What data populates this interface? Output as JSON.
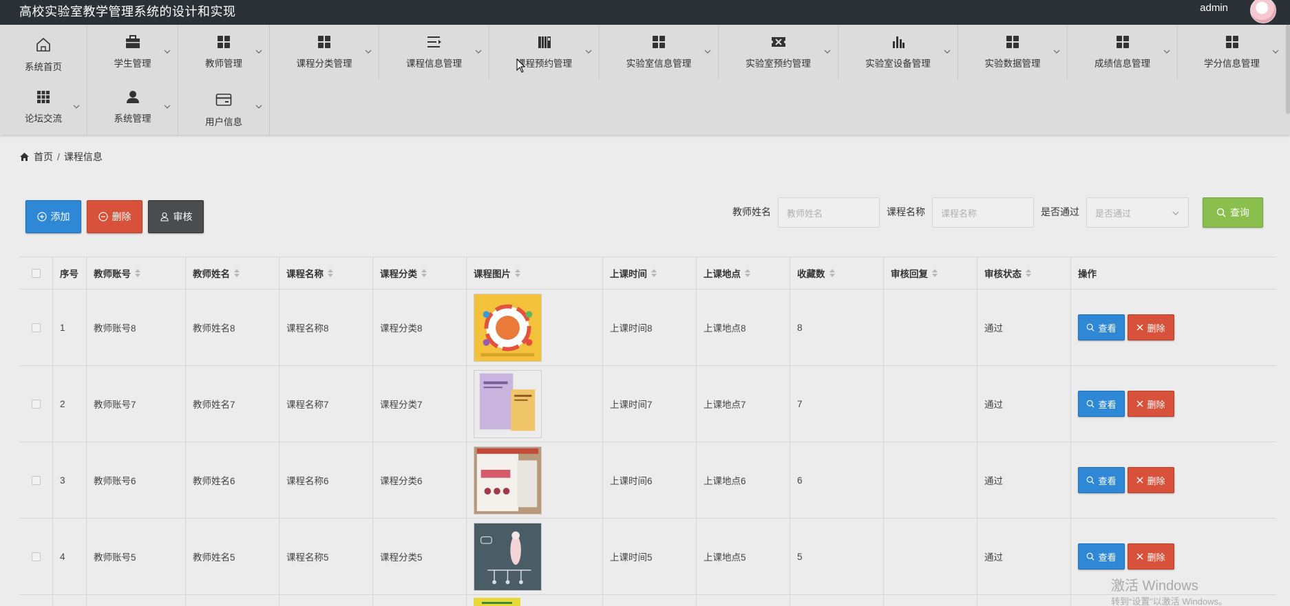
{
  "app": {
    "title": "高校实验室教学管理系统的设计和实现",
    "user": "admin"
  },
  "nav": {
    "row1": [
      {
        "label": "系统首页",
        "icon": "home-icon"
      },
      {
        "label": "学生管理",
        "icon": "briefcase-icon"
      },
      {
        "label": "教师管理",
        "icon": "grid-icon"
      },
      {
        "label": "课程分类管理",
        "icon": "grid-icon"
      },
      {
        "label": "课程信息管理",
        "icon": "list-icon"
      },
      {
        "label": "课程预约管理",
        "icon": "book-icon"
      },
      {
        "label": "实验室信息管理",
        "icon": "grid-icon"
      },
      {
        "label": "实验室预约管理",
        "icon": "ticket-icon"
      },
      {
        "label": "实验室设备管理",
        "icon": "bar-chart-icon"
      },
      {
        "label": "实验数据管理",
        "icon": "grid-icon"
      },
      {
        "label": "成绩信息管理",
        "icon": "grid-icon"
      },
      {
        "label": "学分信息管理",
        "icon": "grid-icon"
      }
    ],
    "row2": [
      {
        "label": "论坛交流",
        "icon": "grid9-icon"
      },
      {
        "label": "系统管理",
        "icon": "user-icon"
      },
      {
        "label": "用户信息",
        "icon": "card-icon"
      }
    ]
  },
  "breadcrumb": {
    "home": "首页",
    "sep": "/",
    "current": "课程信息"
  },
  "actions": {
    "add": "添加",
    "delete": "删除",
    "audit": "审核"
  },
  "search": {
    "teacher_label": "教师姓名",
    "teacher_placeholder": "教师姓名",
    "course_label": "课程名称",
    "course_placeholder": "课程名称",
    "pass_label": "是否通过",
    "pass_placeholder": "是否通过",
    "query": "查询"
  },
  "table": {
    "headers": [
      "序号",
      "教师账号",
      "教师姓名",
      "课程名称",
      "课程分类",
      "课程图片",
      "上课时间",
      "上课地点",
      "收藏数",
      "审核回复",
      "审核状态",
      "操作"
    ],
    "view_label": "查看",
    "delete_label": "删除",
    "rows": [
      {
        "no": "1",
        "account": "教师账号8",
        "name": "教师姓名8",
        "course": "课程名称8",
        "category": "课程分类8",
        "time": "上课时间8",
        "place": "上课地点8",
        "fav": "8",
        "reply": "",
        "status": "通过"
      },
      {
        "no": "2",
        "account": "教师账号7",
        "name": "教师姓名7",
        "course": "课程名称7",
        "category": "课程分类7",
        "time": "上课时间7",
        "place": "上课地点7",
        "fav": "7",
        "reply": "",
        "status": "通过"
      },
      {
        "no": "3",
        "account": "教师账号6",
        "name": "教师姓名6",
        "course": "课程名称6",
        "category": "课程分类6",
        "time": "上课时间6",
        "place": "上课地点6",
        "fav": "6",
        "reply": "",
        "status": "通过"
      },
      {
        "no": "4",
        "account": "教师账号5",
        "name": "教师姓名5",
        "course": "课程名称5",
        "category": "课程分类5",
        "time": "上课时间5",
        "place": "上课地点5",
        "fav": "5",
        "reply": "",
        "status": "通过"
      }
    ]
  },
  "watermark": {
    "line1": "激活 Windows",
    "line2": "转到“设置”以激活 Windows。"
  },
  "colors": {
    "topbar": "#2b3137",
    "primary": "#2e88d6",
    "danger": "#d8513a",
    "dark": "#4a4d50",
    "success": "#8bbf4d"
  }
}
